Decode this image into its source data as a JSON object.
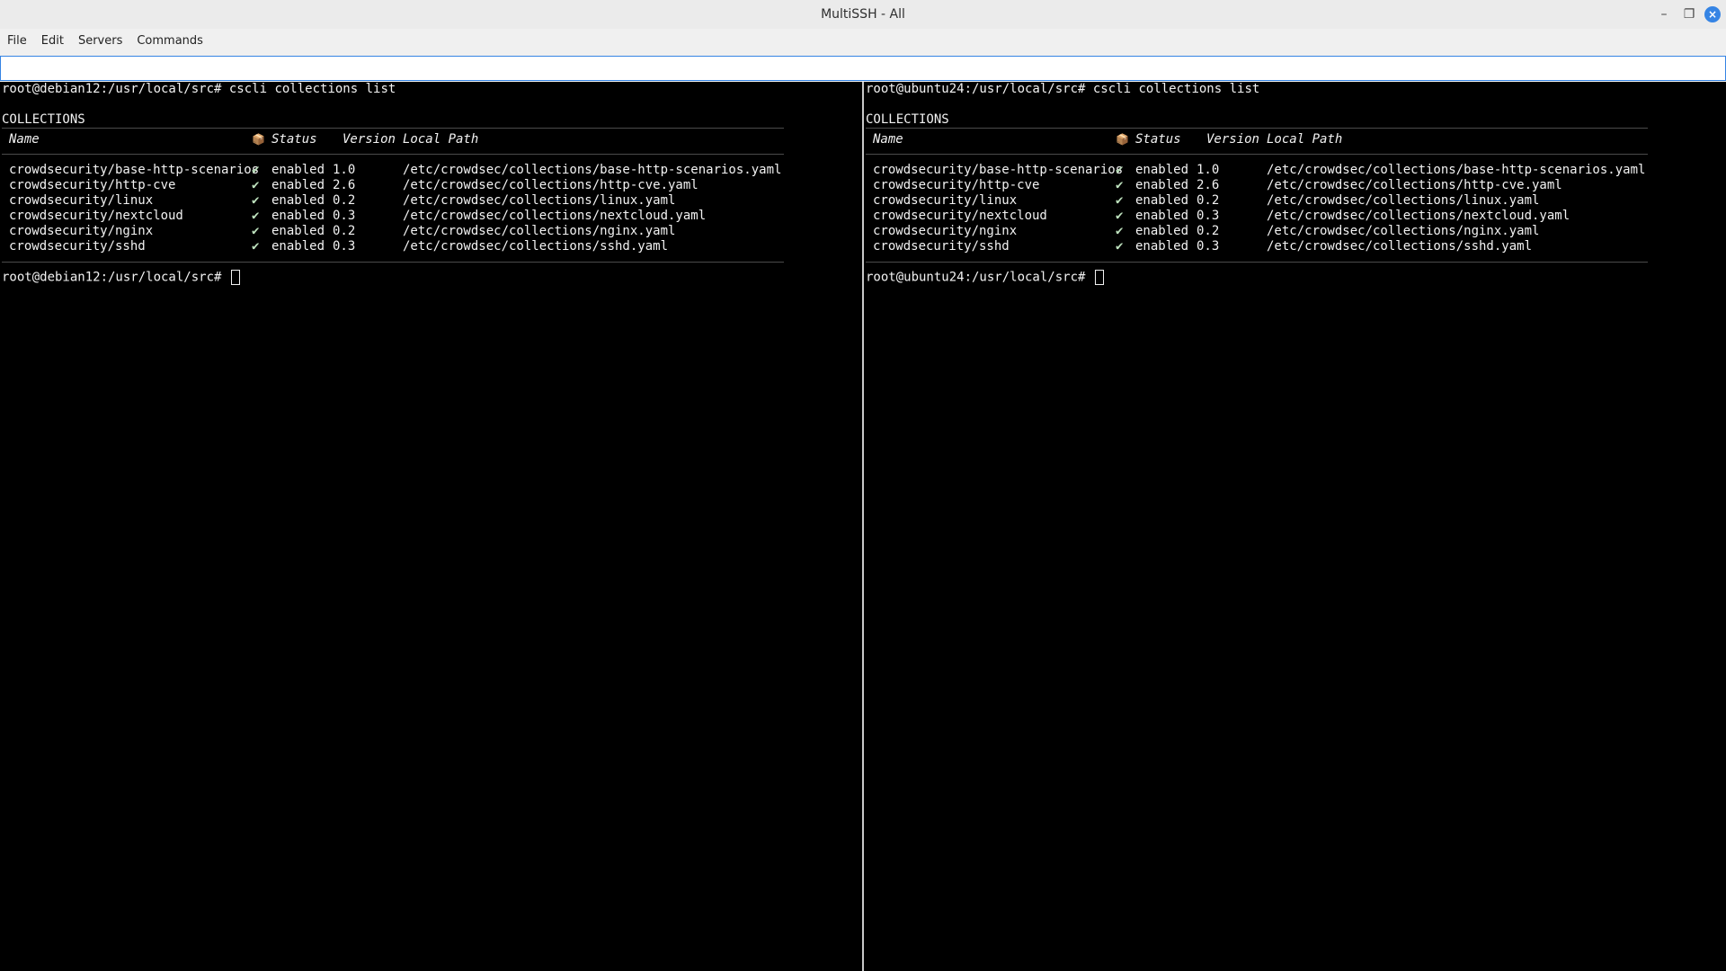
{
  "window": {
    "title": "MultiSSH - All",
    "controls": {
      "minimize": "–",
      "maximize": "❐",
      "close": "×"
    }
  },
  "menu": {
    "items": [
      "File",
      "Edit",
      "Servers",
      "Commands"
    ]
  },
  "command_input": {
    "value": "",
    "placeholder": ""
  },
  "panes": [
    {
      "host": "debian12",
      "prompt": "root@debian12:/usr/local/src#",
      "command": "cscli collections list",
      "section_title": "COLLECTIONS",
      "headers": {
        "name": "Name",
        "status": "Status",
        "version": "Version",
        "path": "Local Path"
      },
      "rows": [
        {
          "name": "crowdsecurity/base-http-scenarios",
          "status": "enabled",
          "version": "1.0",
          "path": "/etc/crowdsec/collections/base-http-scenarios.yaml"
        },
        {
          "name": "crowdsecurity/http-cve",
          "status": "enabled",
          "version": "2.6",
          "path": "/etc/crowdsec/collections/http-cve.yaml"
        },
        {
          "name": "crowdsecurity/linux",
          "status": "enabled",
          "version": "0.2",
          "path": "/etc/crowdsec/collections/linux.yaml"
        },
        {
          "name": "crowdsecurity/nextcloud",
          "status": "enabled",
          "version": "0.3",
          "path": "/etc/crowdsec/collections/nextcloud.yaml"
        },
        {
          "name": "crowdsecurity/nginx",
          "status": "enabled",
          "version": "0.2",
          "path": "/etc/crowdsec/collections/nginx.yaml"
        },
        {
          "name": "crowdsecurity/sshd",
          "status": "enabled",
          "version": "0.3",
          "path": "/etc/crowdsec/collections/sshd.yaml"
        }
      ]
    },
    {
      "host": "ubuntu24",
      "prompt": "root@ubuntu24:/usr/local/src#",
      "command": "cscli collections list",
      "section_title": "COLLECTIONS",
      "headers": {
        "name": "Name",
        "status": "Status",
        "version": "Version",
        "path": "Local Path"
      },
      "rows": [
        {
          "name": "crowdsecurity/base-http-scenarios",
          "status": "enabled",
          "version": "1.0",
          "path": "/etc/crowdsec/collections/base-http-scenarios.yaml"
        },
        {
          "name": "crowdsecurity/http-cve",
          "status": "enabled",
          "version": "2.6",
          "path": "/etc/crowdsec/collections/http-cve.yaml"
        },
        {
          "name": "crowdsecurity/linux",
          "status": "enabled",
          "version": "0.2",
          "path": "/etc/crowdsec/collections/linux.yaml"
        },
        {
          "name": "crowdsecurity/nextcloud",
          "status": "enabled",
          "version": "0.3",
          "path": "/etc/crowdsec/collections/nextcloud.yaml"
        },
        {
          "name": "crowdsecurity/nginx",
          "status": "enabled",
          "version": "0.2",
          "path": "/etc/crowdsec/collections/nginx.yaml"
        },
        {
          "name": "crowdsecurity/sshd",
          "status": "enabled",
          "version": "0.3",
          "path": "/etc/crowdsec/collections/sshd.yaml"
        }
      ]
    }
  ],
  "icons": {
    "check": "✔",
    "package": "📦"
  },
  "colors": {
    "terminal_bg": "#000000",
    "terminal_fg": "#f2f2f2",
    "focus_border": "#3584e4"
  }
}
